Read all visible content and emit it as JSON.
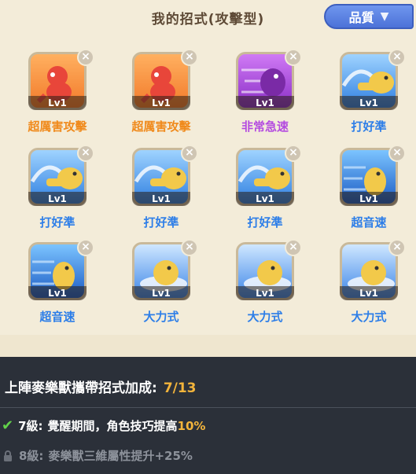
{
  "panel": {
    "title": "我的招式(攻擊型)",
    "quality_button": "品質"
  },
  "moves": [
    {
      "name": "超厲害攻擊",
      "level": "Lv1",
      "style": "orange",
      "name_color": "#f08a1c"
    },
    {
      "name": "超厲害攻擊",
      "level": "Lv1",
      "style": "orange",
      "name_color": "#f08a1c"
    },
    {
      "name": "非常急速",
      "level": "Lv1",
      "style": "purple",
      "name_color": "#b44be0"
    },
    {
      "name": "打好準",
      "level": "Lv1",
      "style": "blue",
      "name_color": "#2d7ee8"
    },
    {
      "name": "打好準",
      "level": "Lv1",
      "style": "blue",
      "name_color": "#2d7ee8"
    },
    {
      "name": "打好準",
      "level": "Lv1",
      "style": "blue",
      "name_color": "#2d7ee8"
    },
    {
      "name": "打好準",
      "level": "Lv1",
      "style": "blue",
      "name_color": "#2d7ee8"
    },
    {
      "name": "超音速",
      "level": "Lv1",
      "style": "speed",
      "name_color": "#2d7ee8"
    },
    {
      "name": "超音速",
      "level": "Lv1",
      "style": "speed",
      "name_color": "#2d7ee8"
    },
    {
      "name": "大力式",
      "level": "Lv1",
      "style": "power",
      "name_color": "#2d7ee8"
    },
    {
      "name": "大力式",
      "level": "Lv1",
      "style": "power",
      "name_color": "#2d7ee8"
    },
    {
      "name": "大力式",
      "level": "Lv1",
      "style": "power",
      "name_color": "#2d7ee8"
    }
  ],
  "info": {
    "heading": "上陣麥樂獸攜帶招式加成:",
    "count": "7/13",
    "tier1_level": "7級:",
    "tier1_text": "覺醒期間，角色技巧提高",
    "tier1_value": "10%",
    "tier2_level": "8級:",
    "tier2_text": "麥樂獸三維屬性提升+25%"
  }
}
